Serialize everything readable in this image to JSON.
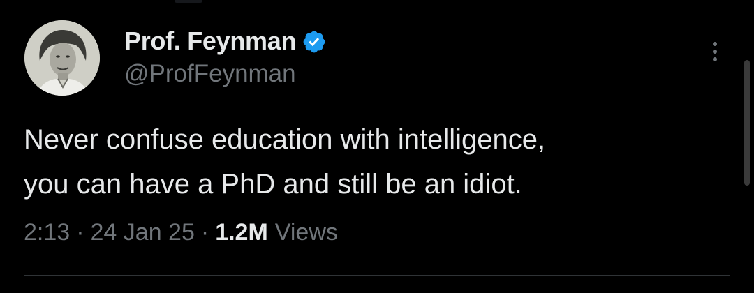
{
  "author": {
    "display_name": "Prof. Feynman",
    "handle": "@ProfFeynman",
    "verified": true,
    "verified_color": "#1d9bf0"
  },
  "tweet": {
    "text_lines": [
      "Never confuse education with intelligence,",
      "you can have a PhD and still be an idiot."
    ]
  },
  "meta": {
    "time": "2:13",
    "date": "24 Jan 25",
    "views_count": "1.2M",
    "views_label": "Views",
    "separator": "·"
  },
  "icons": {
    "more": "more-vertical-icon",
    "verified": "verified-badge-icon"
  },
  "colors": {
    "background": "#000000",
    "primary_text": "#e7e9ea",
    "secondary_text": "#71767b",
    "divider": "#2f3336"
  }
}
